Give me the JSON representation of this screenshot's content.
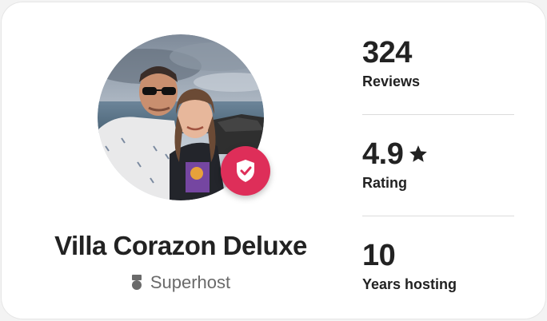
{
  "host": {
    "name": "Villa Corazon Deluxe",
    "status": "Superhost",
    "verified_badge_icon": "shield-check-icon",
    "superhost_icon": "superhost-medal-icon",
    "badge_color": "#de2e59"
  },
  "stats": {
    "reviews": {
      "value": "324",
      "label": "Reviews"
    },
    "rating": {
      "value": "4.9",
      "label": "Rating",
      "icon": "star-icon"
    },
    "years": {
      "value": "10",
      "label": "Years hosting"
    }
  }
}
